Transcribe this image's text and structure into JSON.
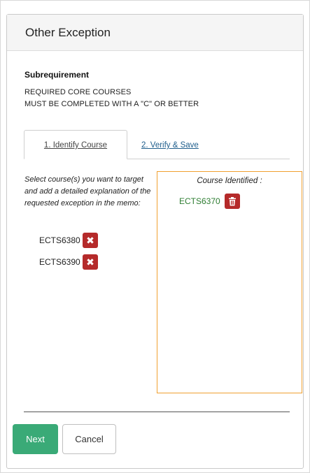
{
  "dialog": {
    "title": "Other Exception"
  },
  "subrequirement": {
    "heading": "Subrequirement",
    "line1": "REQUIRED CORE COURSES",
    "line2": "MUST BE COMPLETED WITH A \"C\" OR BETTER"
  },
  "tabs": [
    {
      "label": "1. Identify Course",
      "active": true
    },
    {
      "label": "2. Verify & Save",
      "active": false
    }
  ],
  "instructions": "Select course(s) you want to target and add a detailed explanation of the requested exception in the memo:",
  "available_courses": [
    {
      "code": "ECTS6380",
      "remove_icon": "x-icon"
    },
    {
      "code": "ECTS6390",
      "remove_icon": "x-icon"
    }
  ],
  "identified": {
    "title": "Course Identified :",
    "courses": [
      {
        "code": "ECTS6370",
        "delete_icon": "trash-icon"
      }
    ]
  },
  "buttons": {
    "next": "Next",
    "cancel": "Cancel"
  },
  "colors": {
    "next_button": "#3aaa77",
    "remove_button": "#b52a2a",
    "identified_border": "#f0a030",
    "identified_text": "#2e7d32",
    "tab_link": "#1f5e8c"
  }
}
